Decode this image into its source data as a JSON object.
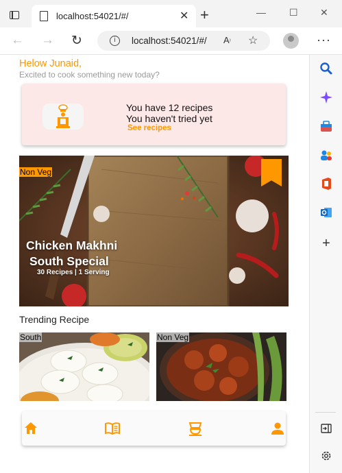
{
  "browser": {
    "tab_title": "localhost:54021/#/",
    "tab_close": "✕",
    "new_tab": "+",
    "url": "localhost:54021/#/",
    "window_controls": [
      "—",
      "☐",
      "✕"
    ],
    "nav_icons": [
      "back-icon",
      "forward-icon",
      "refresh-icon"
    ],
    "sidebar_icons": [
      "search-icon",
      "copilot-icon",
      "shopping-icon",
      "people-icon",
      "office-icon",
      "outlook-icon",
      "add-icon",
      "hide-sidebar-icon",
      "settings-icon"
    ]
  },
  "header": {
    "greeting": "Helow Junaid,",
    "subtitle": "Excited to cook something new today?"
  },
  "banner": {
    "line1": "You have 12 recipes",
    "line2": "You haven't tried yet",
    "link": "See recipes"
  },
  "featured": {
    "tag": "Non Veg",
    "title1": "Chicken Makhni",
    "title2": "South Special",
    "meta": "30 Recipes | 1 Serving"
  },
  "trending": {
    "heading": "Trending Recipe",
    "cards": [
      {
        "tag": "South"
      },
      {
        "tag": "Non Veg"
      }
    ]
  },
  "bottom_nav": {
    "items": [
      "home-icon",
      "recipe-book-icon",
      "food-icon",
      "profile-icon"
    ]
  },
  "colors": {
    "accent": "#ff9800",
    "banner_bg": "#fde8e8"
  }
}
